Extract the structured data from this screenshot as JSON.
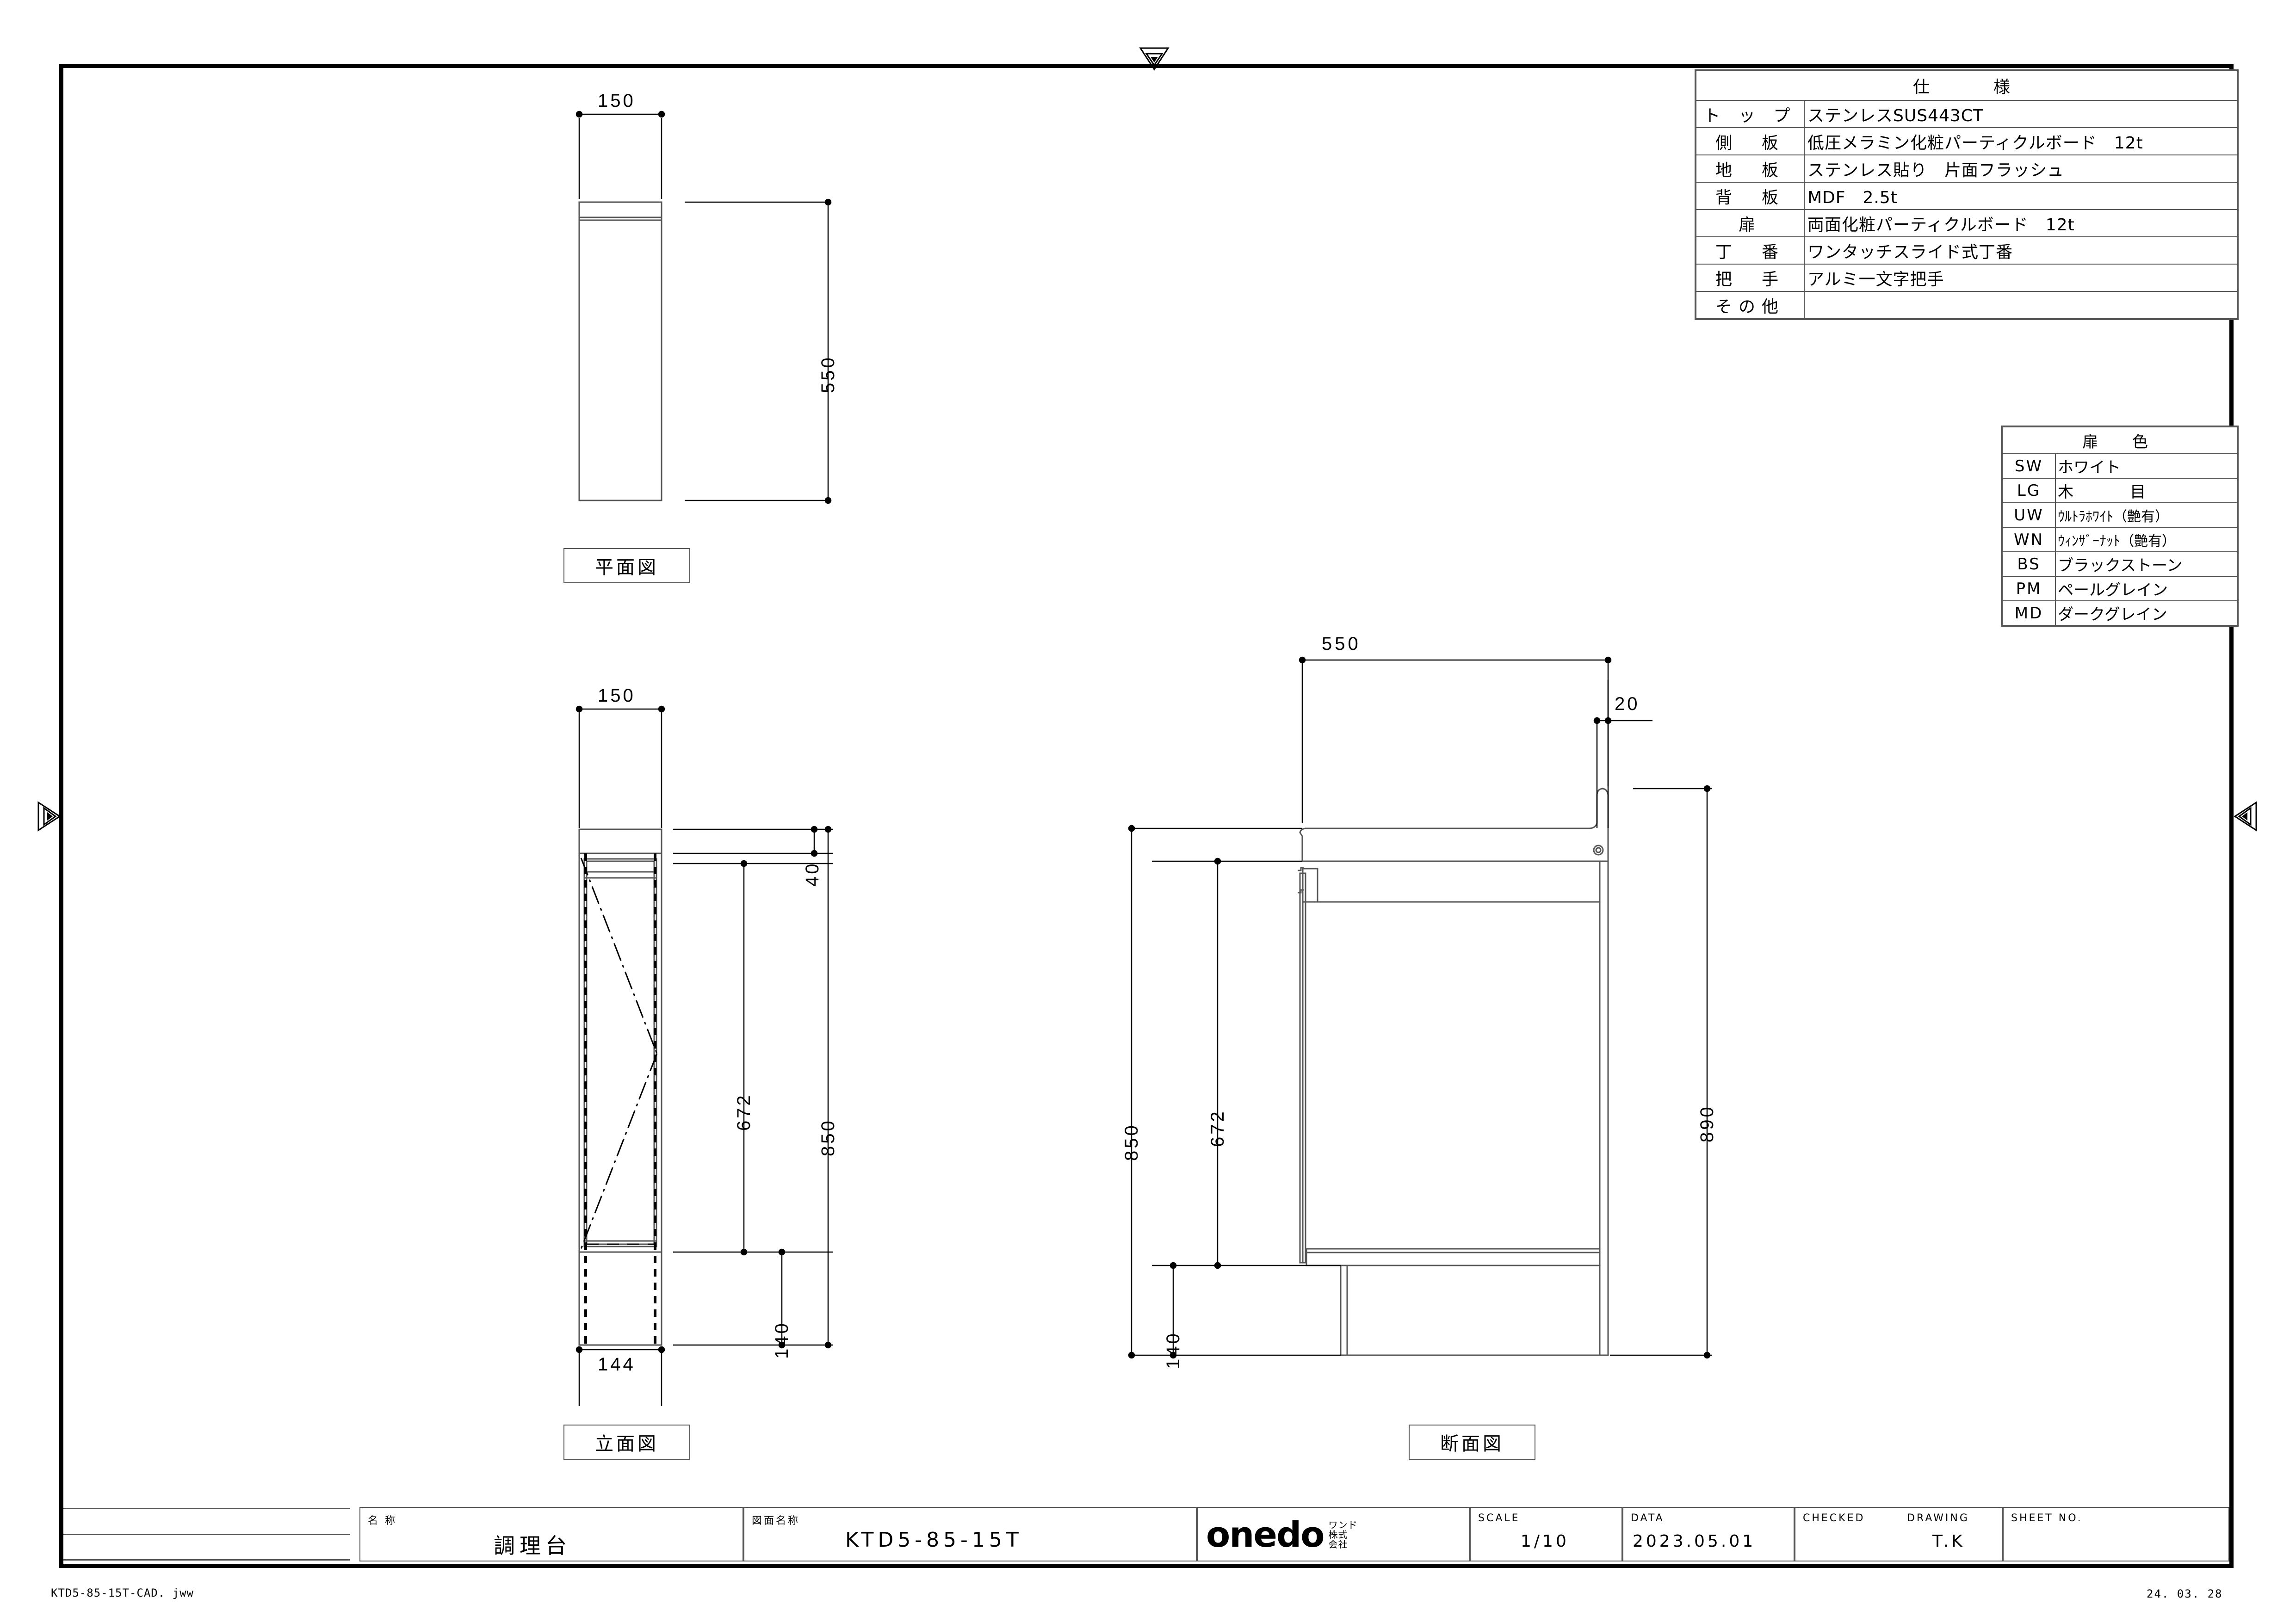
{
  "sheet": {
    "file_name": "KTD5-85-15T-CAD. jww",
    "print_date": "24. 03. 28"
  },
  "spec_table": {
    "title": "仕　　様",
    "rows": [
      {
        "key": "ト ッ プ",
        "value": "ステンレスSUS443CT"
      },
      {
        "key": "側　板",
        "value": "低圧メラミン化粧パーティクルボード　12t"
      },
      {
        "key": "地　板",
        "value": "ステンレス貼り　片面フラッシュ"
      },
      {
        "key": "背　板",
        "value": "MDF　2.5t"
      },
      {
        "key": "扉",
        "value": "両面化粧パーティクルボード　12t"
      },
      {
        "key": "丁　番",
        "value": "ワンタッチスライド式丁番"
      },
      {
        "key": "把　手",
        "value": "アルミ一文字把手"
      },
      {
        "key": "その他",
        "value": ""
      }
    ]
  },
  "color_table": {
    "title": "扉　色",
    "rows": [
      {
        "code": "SW",
        "name": "ホワイト"
      },
      {
        "code": "LG",
        "name": "木　　目"
      },
      {
        "code": "UW",
        "name": "ｳﾙﾄﾗﾎﾜｲﾄ（艶有）"
      },
      {
        "code": "WN",
        "name": "ｳｨﾝｻﾞｰﾅｯﾄ（艶有）"
      },
      {
        "code": "BS",
        "name": "ブラックストーン"
      },
      {
        "code": "PM",
        "name": "ペールグレイン"
      },
      {
        "code": "MD",
        "name": "ダークグレイン"
      }
    ]
  },
  "views": {
    "plan": {
      "label": "平面図",
      "dim_width": "150",
      "dim_depth": "550"
    },
    "elevation": {
      "label": "立面図",
      "dim_top_width": "150",
      "dim_bottom_width": "144",
      "dim_top_band": "40",
      "dim_door": "672",
      "dim_total": "850",
      "dim_base": "140"
    },
    "section": {
      "label": "断面図",
      "dim_depth": "550",
      "dim_overhang": "20",
      "dim_total": "850",
      "dim_door": "672",
      "dim_base": "140",
      "dim_overall": "890"
    }
  },
  "title_block": {
    "name_label": "名 称",
    "name_value": "調理台",
    "drawing_label": "図面名称",
    "drawing_value": "KTD5-85-15T",
    "company_logo": "onedo",
    "company_jp_top": "ワンド",
    "company_jp_mid": "株式",
    "company_jp_bot": "会社",
    "scale_label": "SCALE",
    "scale_value": "1/10",
    "date_label": "DATA",
    "date_value": "2023.05.01",
    "checked_label": "CHECKED",
    "checked_value": "",
    "drawing_by_label": "DRAWING",
    "drawing_by_value": "T.K",
    "sheet_label": "SHEET NO.",
    "sheet_value": ""
  }
}
